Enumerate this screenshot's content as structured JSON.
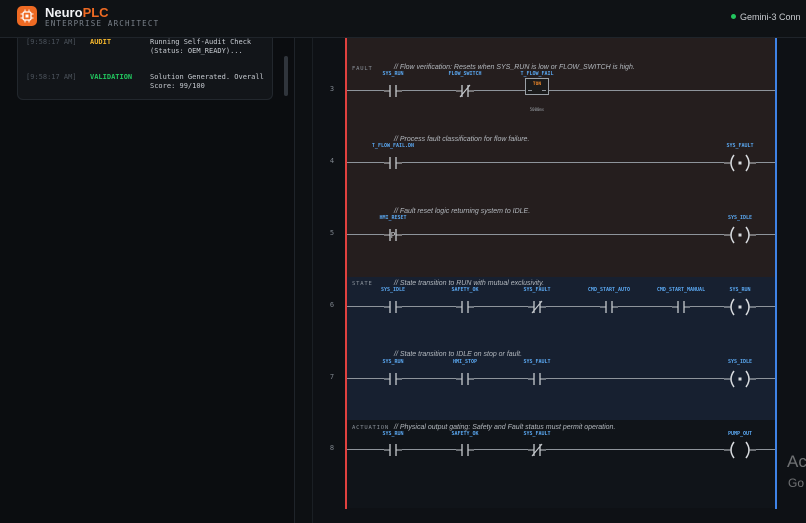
{
  "header": {
    "brand_part1": "Neuro",
    "brand_part2": "PLC",
    "subtitle": "ENTERPRISE ARCHITECT",
    "connection_label": "Gemini-3 Conn",
    "connection_color": "#22c55e",
    "accent_color": "#ee6a23"
  },
  "log": {
    "entries": [
      {
        "time": "[9:58:17 AM]",
        "tag": "AUDIT",
        "tag_color": "#f5b72c",
        "message": "Running Self-Audit Check (Status: OEM_READY)..."
      },
      {
        "time": "[9:58:17 AM]",
        "tag": "VALIDATION",
        "tag_color": "#22c55e",
        "message": "Solution Generated. Overall Score: 99/100"
      }
    ]
  },
  "ladder": {
    "rail_left_color": "#e0413f",
    "rail_right_color": "#3f83e6",
    "sections": {
      "fault": "FAULT",
      "state": "STATE",
      "actuation": "ACTUATION"
    },
    "rungs": [
      {
        "number": "3",
        "comment": "// Flow verification: Resets when SYS_RUN is low or FLOW_SWITCH is high.",
        "contacts": [
          {
            "tag": "SYS_RUN",
            "type": "no"
          },
          {
            "tag": "FLOW_SWITCH",
            "type": "nc"
          }
        ],
        "timer": {
          "tag": "T_FLOW_FAIL",
          "type": "TON",
          "preset": "5000ms"
        }
      },
      {
        "number": "4",
        "comment": "// Process fault classification for flow failure.",
        "contacts": [
          {
            "tag": "T_FLOW_FAIL.DN",
            "type": "no"
          }
        ],
        "coil": {
          "tag": "SYS_FAULT",
          "type": "set"
        }
      },
      {
        "number": "5",
        "comment": "// Fault reset logic returning system to IDLE.",
        "contacts": [
          {
            "tag": "HMI_RESET",
            "type": "pos"
          }
        ],
        "coil": {
          "tag": "SYS_IDLE",
          "type": "set"
        }
      },
      {
        "number": "6",
        "comment": "// State transition to RUN with mutual exclusivity.",
        "contacts": [
          {
            "tag": "SYS_IDLE",
            "type": "no"
          },
          {
            "tag": "SAFETY_OK",
            "type": "no"
          },
          {
            "tag": "SYS_FAULT",
            "type": "nc"
          },
          {
            "tag": "CMD_START_AUTO",
            "type": "no"
          },
          {
            "tag": "CMD_START_MANUAL",
            "type": "no"
          }
        ],
        "coil": {
          "tag": "SYS_RUN",
          "type": "set"
        }
      },
      {
        "number": "7",
        "comment": "// State transition to IDLE on stop or fault.",
        "contacts": [
          {
            "tag": "SYS_RUN",
            "type": "no"
          },
          {
            "tag": "HMI_STOP",
            "type": "no"
          },
          {
            "tag": "SYS_FAULT",
            "type": "no"
          }
        ],
        "coil": {
          "tag": "SYS_IDLE",
          "type": "set"
        }
      },
      {
        "number": "8",
        "comment": "// Physical output gating: Safety and Fault status must permit operation.",
        "contacts": [
          {
            "tag": "SYS_RUN",
            "type": "no"
          },
          {
            "tag": "SAFETY_OK",
            "type": "no"
          },
          {
            "tag": "SYS_FAULT",
            "type": "nc"
          }
        ],
        "coil": {
          "tag": "PUMP_OUT",
          "type": "out"
        }
      }
    ]
  },
  "watermark": {
    "line1": "Ac",
    "line2": "Go"
  }
}
